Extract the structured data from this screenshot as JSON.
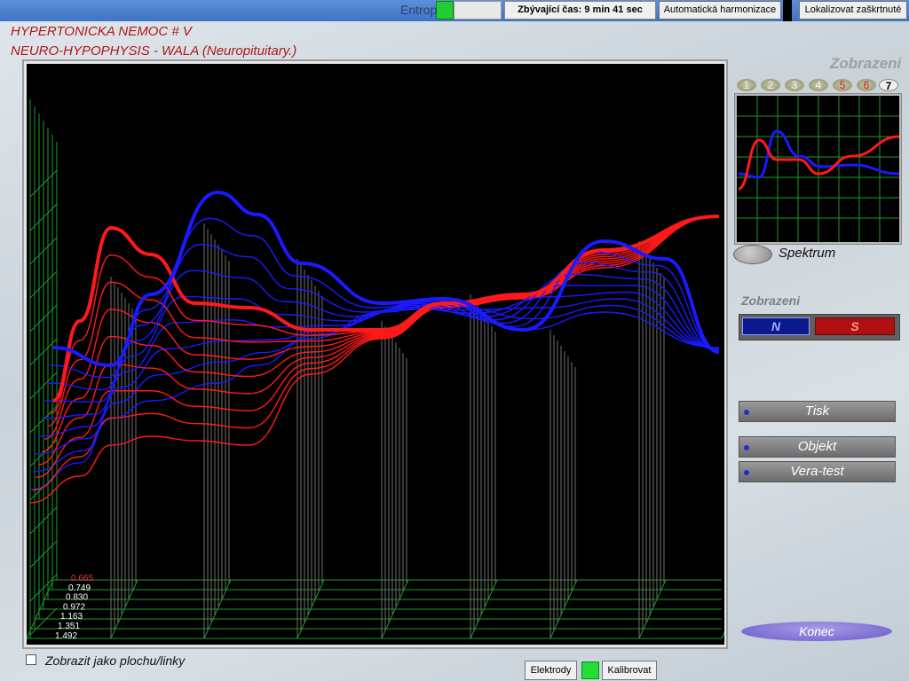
{
  "topbar": {
    "entropy_label": "Entrop",
    "time_label": "Zbývající čas: 9 min 41 sec",
    "auto_harmonize": "Automatická harmonizace",
    "localize_checked": "Lokalizovat zaškrtnuté"
  },
  "header": {
    "title_line1": "HYPERTONICKA NEMOC # V",
    "title_line2": "NEURO-HYPOPHYSIS  -  WALA  (Neuropituitary.)"
  },
  "plot": {
    "scale_labels": [
      "0.665",
      "0.749",
      "0.830",
      "0.972",
      "1.163",
      "1.351",
      "1.492"
    ],
    "colors": {
      "background": "#000000",
      "grid": "#1f9a2a",
      "red": "#ff1a1a",
      "blue": "#1a1aff",
      "label_first": "#ff3030",
      "label": "#ffffff"
    }
  },
  "bottom": {
    "toggle_label": "Zobrazit jako plochu/linky",
    "electrodes": "Elektrody",
    "calibrate": "Kalibrovat"
  },
  "right": {
    "zobrazeni_top": "Zobrazeni",
    "tabs": [
      "1",
      "2",
      "3",
      "4",
      "5",
      "6",
      "7"
    ],
    "spectrum": "Spektrum",
    "zobrazeni_mid": "Zobrazeni",
    "n_label": "N",
    "s_label": "S",
    "print": "Tisk",
    "object": "Objekt",
    "vera": "Vera-test",
    "end": "Konec"
  }
}
